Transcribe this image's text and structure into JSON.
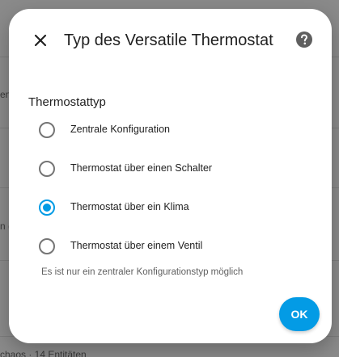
{
  "background": {
    "partial_texts": [
      "en",
      "n (",
      "chaos · 14 Entitäten"
    ]
  },
  "dialog": {
    "title": "Typ des Versatile Thermostat",
    "section_title": "Thermostattyp",
    "options": [
      {
        "label": "Zentrale Konfiguration",
        "checked": false
      },
      {
        "label": "Thermostat über einen Schalter",
        "checked": false
      },
      {
        "label": "Thermostat über ein Klima",
        "checked": true
      },
      {
        "label": "Thermostat über einem Ventil",
        "checked": false
      }
    ],
    "helper_text": "Es ist nur ein zentraler Konfigurationstyp möglich",
    "ok_label": "OK"
  },
  "colors": {
    "accent": "#039be5",
    "scrim": "#8a8a8a"
  },
  "icons": {
    "close": "close-icon",
    "help": "help-icon"
  }
}
